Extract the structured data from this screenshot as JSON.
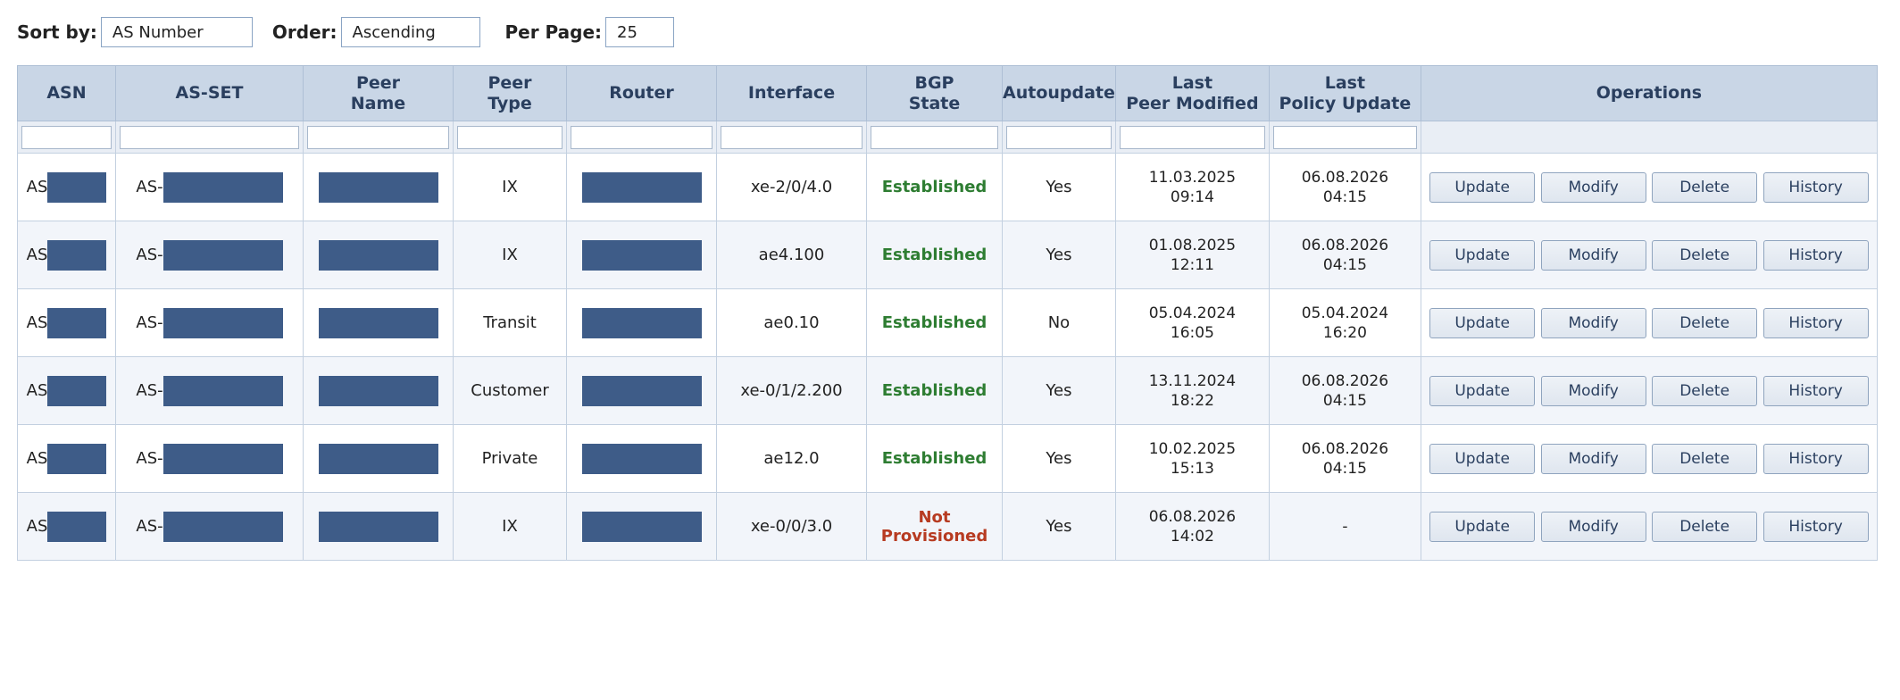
{
  "controls": {
    "sort_label": "Sort by:",
    "sort_value": "AS Number",
    "order_label": "Order:",
    "order_value": "Ascending",
    "perpage_label": "Per Page:",
    "perpage_value": "25"
  },
  "columns": {
    "asn": "ASN",
    "asset": "AS-SET",
    "peer_name_1": "Peer",
    "peer_name_2": "Name",
    "peer_type_1": "Peer",
    "peer_type_2": "Type",
    "router": "Router",
    "interface": "Interface",
    "bgp_1": "BGP",
    "bgp_2": "State",
    "autoupdate": "Autoupdate",
    "last_peer_1": "Last",
    "last_peer_2": "Peer Modified",
    "last_policy_1": "Last",
    "last_policy_2": "Policy Update",
    "operations": "Operations"
  },
  "buttons": {
    "update": "Update",
    "modify": "Modify",
    "delete": "Delete",
    "history": "History"
  },
  "colors": {
    "established": "#2e7d32",
    "not_provisioned": "#b73b21",
    "redaction": "#3e5c88"
  },
  "rows": [
    {
      "asn_prefix": "AS",
      "asset_prefix": "AS-",
      "peer_type": "IX",
      "interface": "xe-2/0/4.0",
      "bgp_state": "Established",
      "autoupdate": "Yes",
      "peer_mod_date": "11.03.2025",
      "peer_mod_time": "09:14",
      "policy_date": "06.08.2026",
      "policy_time": "04:15"
    },
    {
      "asn_prefix": "AS",
      "asset_prefix": "AS-",
      "peer_type": "IX",
      "interface": "ae4.100",
      "bgp_state": "Established",
      "autoupdate": "Yes",
      "peer_mod_date": "01.08.2025",
      "peer_mod_time": "12:11",
      "policy_date": "06.08.2026",
      "policy_time": "04:15"
    },
    {
      "asn_prefix": "AS",
      "asset_prefix": "AS-",
      "peer_type": "Transit",
      "interface": "ae0.10",
      "bgp_state": "Established",
      "autoupdate": "No",
      "peer_mod_date": "05.04.2024",
      "peer_mod_time": "16:05",
      "policy_date": "05.04.2024",
      "policy_time": "16:20"
    },
    {
      "asn_prefix": "AS",
      "asset_prefix": "AS-",
      "peer_type": "Customer",
      "interface": "xe-0/1/2.200",
      "bgp_state": "Established",
      "autoupdate": "Yes",
      "peer_mod_date": "13.11.2024",
      "peer_mod_time": "18:22",
      "policy_date": "06.08.2026",
      "policy_time": "04:15"
    },
    {
      "asn_prefix": "AS",
      "asset_prefix": "AS-",
      "peer_type": "Private",
      "interface": "ae12.0",
      "bgp_state": "Established",
      "autoupdate": "Yes",
      "peer_mod_date": "10.02.2025",
      "peer_mod_time": "15:13",
      "policy_date": "06.08.2026",
      "policy_time": "04:15"
    },
    {
      "asn_prefix": "AS",
      "asset_prefix": "AS-",
      "peer_type": "IX",
      "interface": "xe-0/0/3.0",
      "bgp_state": "Not Provisioned",
      "autoupdate": "Yes",
      "peer_mod_date": "06.08.2026",
      "peer_mod_time": "14:02",
      "policy_date": "-",
      "policy_time": ""
    }
  ]
}
